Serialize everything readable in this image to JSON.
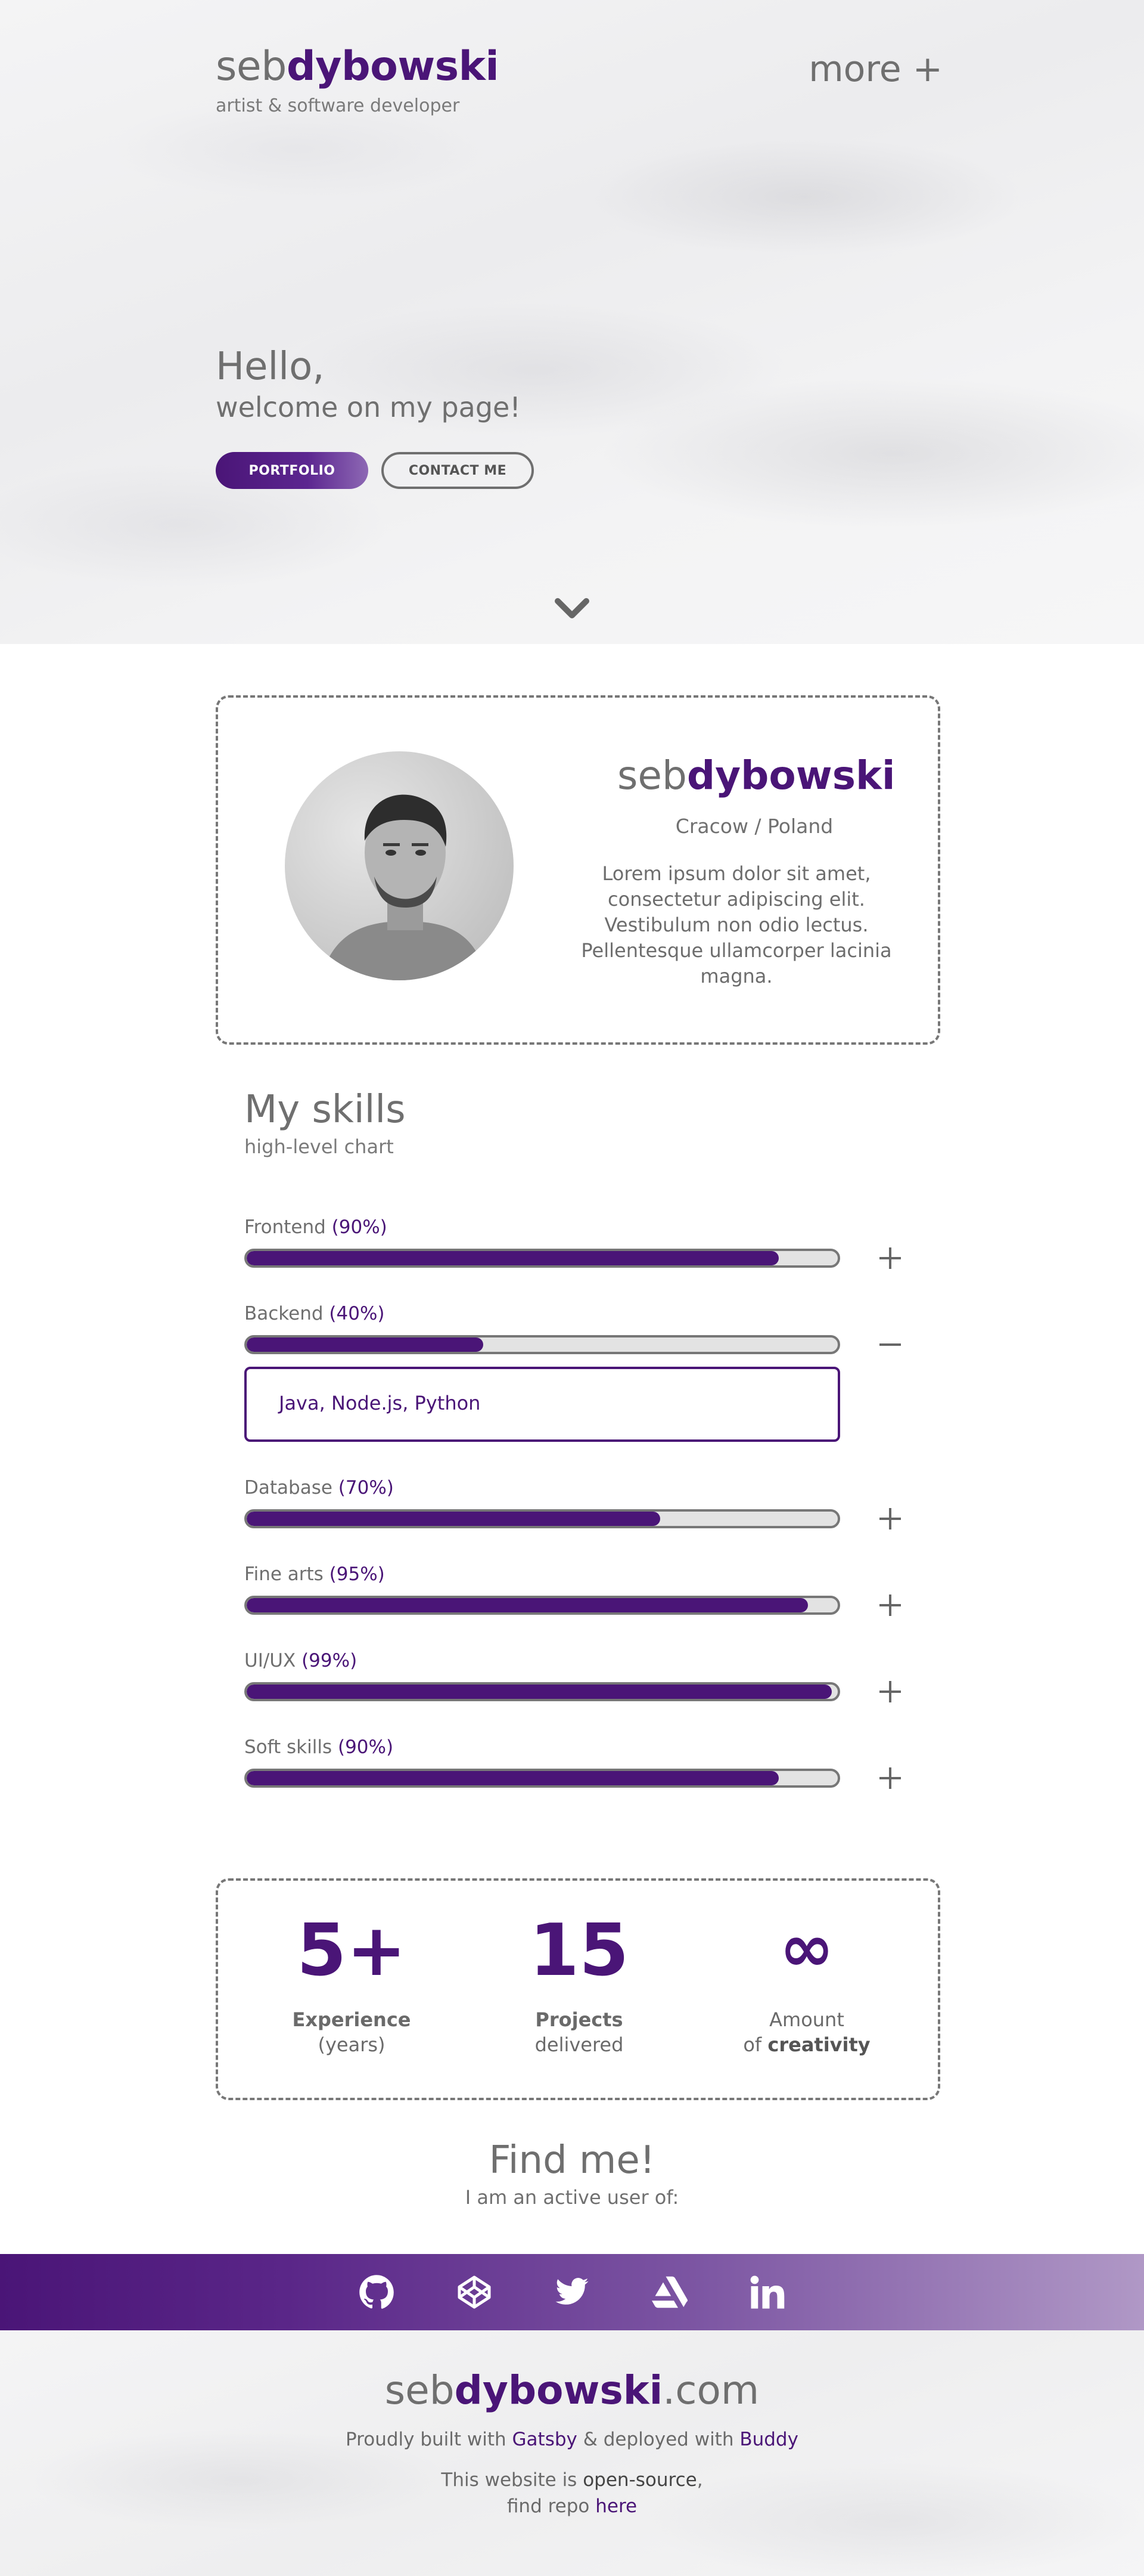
{
  "header": {
    "brand_light": "seb",
    "brand_bold": "dybowski",
    "tagline": "artist & software developer",
    "more_label": "more +"
  },
  "hero": {
    "title": "Hello,",
    "subtitle": "welcome on my page!",
    "primary_button": "PORTFOLIO",
    "secondary_button": "CONTACT ME",
    "scroll_icon": "chevron-down-icon"
  },
  "profile": {
    "name_light": "seb",
    "name_bold": "dybowski",
    "location": "Cracow / Poland",
    "bio": "Lorem ipsum dolor sit amet, consectetur adipiscing elit. Vestibulum non odio lectus. Pellentesque ullamcorper lacinia magna."
  },
  "skills": {
    "title": "My skills",
    "subtitle": "high-level chart",
    "items": [
      {
        "name": "Frontend",
        "percent_label": "(90%)",
        "level": 0.9,
        "toggle": "+",
        "expanded": false
      },
      {
        "name": "Backend",
        "percent_label": "(40%)",
        "level": 0.4,
        "toggle": "−",
        "expanded": true,
        "details": "Java, Node.js, Python"
      },
      {
        "name": "Database",
        "percent_label": "(70%)",
        "level": 0.7,
        "toggle": "+",
        "expanded": false
      },
      {
        "name": "Fine arts",
        "percent_label": "(95%)",
        "level": 0.95,
        "toggle": "+",
        "expanded": false
      },
      {
        "name": "UI/UX",
        "percent_label": "(99%)",
        "level": 0.99,
        "toggle": "+",
        "expanded": false
      },
      {
        "name": "Soft skills",
        "percent_label": "(90%)",
        "level": 0.9,
        "toggle": "+",
        "expanded": false
      }
    ]
  },
  "stats": [
    {
      "value": "5+",
      "line1": "Experience",
      "line2": "(years)"
    },
    {
      "value": "15",
      "line1": "Projects",
      "line2": "delivered"
    },
    {
      "value": "∞",
      "line1": "Amount",
      "line2_prefix": "of ",
      "line2_bold": "creativity"
    }
  ],
  "find_me": {
    "title": "Find me!",
    "subtitle": "I am an active user of:",
    "icons": [
      "github-icon",
      "codepen-icon",
      "twitter-icon",
      "artstation-icon",
      "linkedin-icon"
    ]
  },
  "footer": {
    "brand_light": "seb",
    "brand_bold": "dybowski",
    "brand_suffix": ".com",
    "built_prefix": "Proudly built with ",
    "built_link1": "Gatsby",
    "built_mid": " & deployed with ",
    "built_link2": "Buddy",
    "oss_prefix": "This website is ",
    "oss_bold": "open-source",
    "oss_suffix": ",",
    "repo_prefix": "find repo ",
    "repo_link": "here"
  },
  "colors": {
    "accent": "#4a1577",
    "text": "#6f6f6f",
    "bar_track": "#e3e3e3"
  }
}
